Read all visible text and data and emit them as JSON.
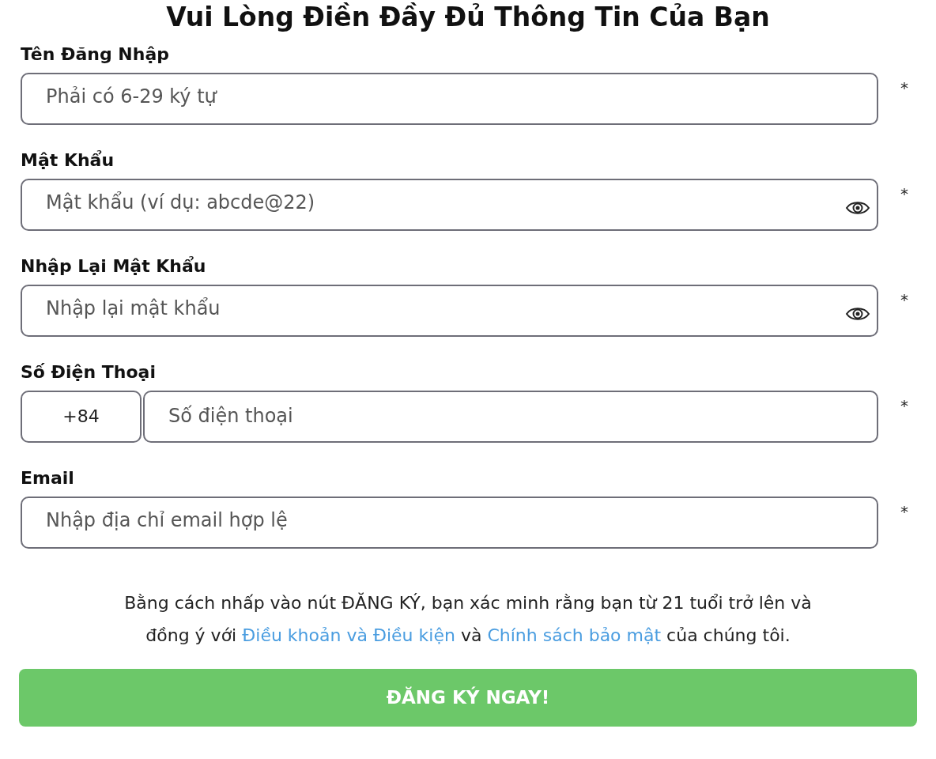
{
  "title": "Vui Lòng Điền Đầy Đủ Thông Tin Của Bạn",
  "fields": [
    {
      "kind": "text",
      "label": "Tên Đăng Nhập",
      "placeholder": "Phải có 6-29 ký tự",
      "required_mark": "*"
    },
    {
      "kind": "password",
      "label": "Mật Khẩu",
      "placeholder": "Mật khẩu (ví dụ: abcde@22)",
      "required_mark": "*"
    },
    {
      "kind": "password",
      "label": "Nhập Lại Mật Khẩu",
      "placeholder": "Nhập lại mật khẩu",
      "required_mark": "*"
    },
    {
      "kind": "phone",
      "label": "Số Điện Thoại",
      "prefix": "+84",
      "placeholder": "Số điện thoại",
      "required_mark": "*"
    },
    {
      "kind": "text",
      "label": "Email",
      "placeholder": "Nhập địa chỉ email hợp lệ",
      "required_mark": "*"
    }
  ],
  "terms": {
    "line_1": "Bằng cách nhấp vào nút ĐĂNG KÝ, bạn xác minh rằng bạn từ 21 tuổi trở lên và",
    "before": "đồng ý với",
    "link_1": "Điều khoản và Điều kiện",
    "middle": "và",
    "link_2": "Chính sách bảo mật",
    "after": "của chúng tôi."
  },
  "submit_button": "ĐĂNG KÝ NGAY!"
}
